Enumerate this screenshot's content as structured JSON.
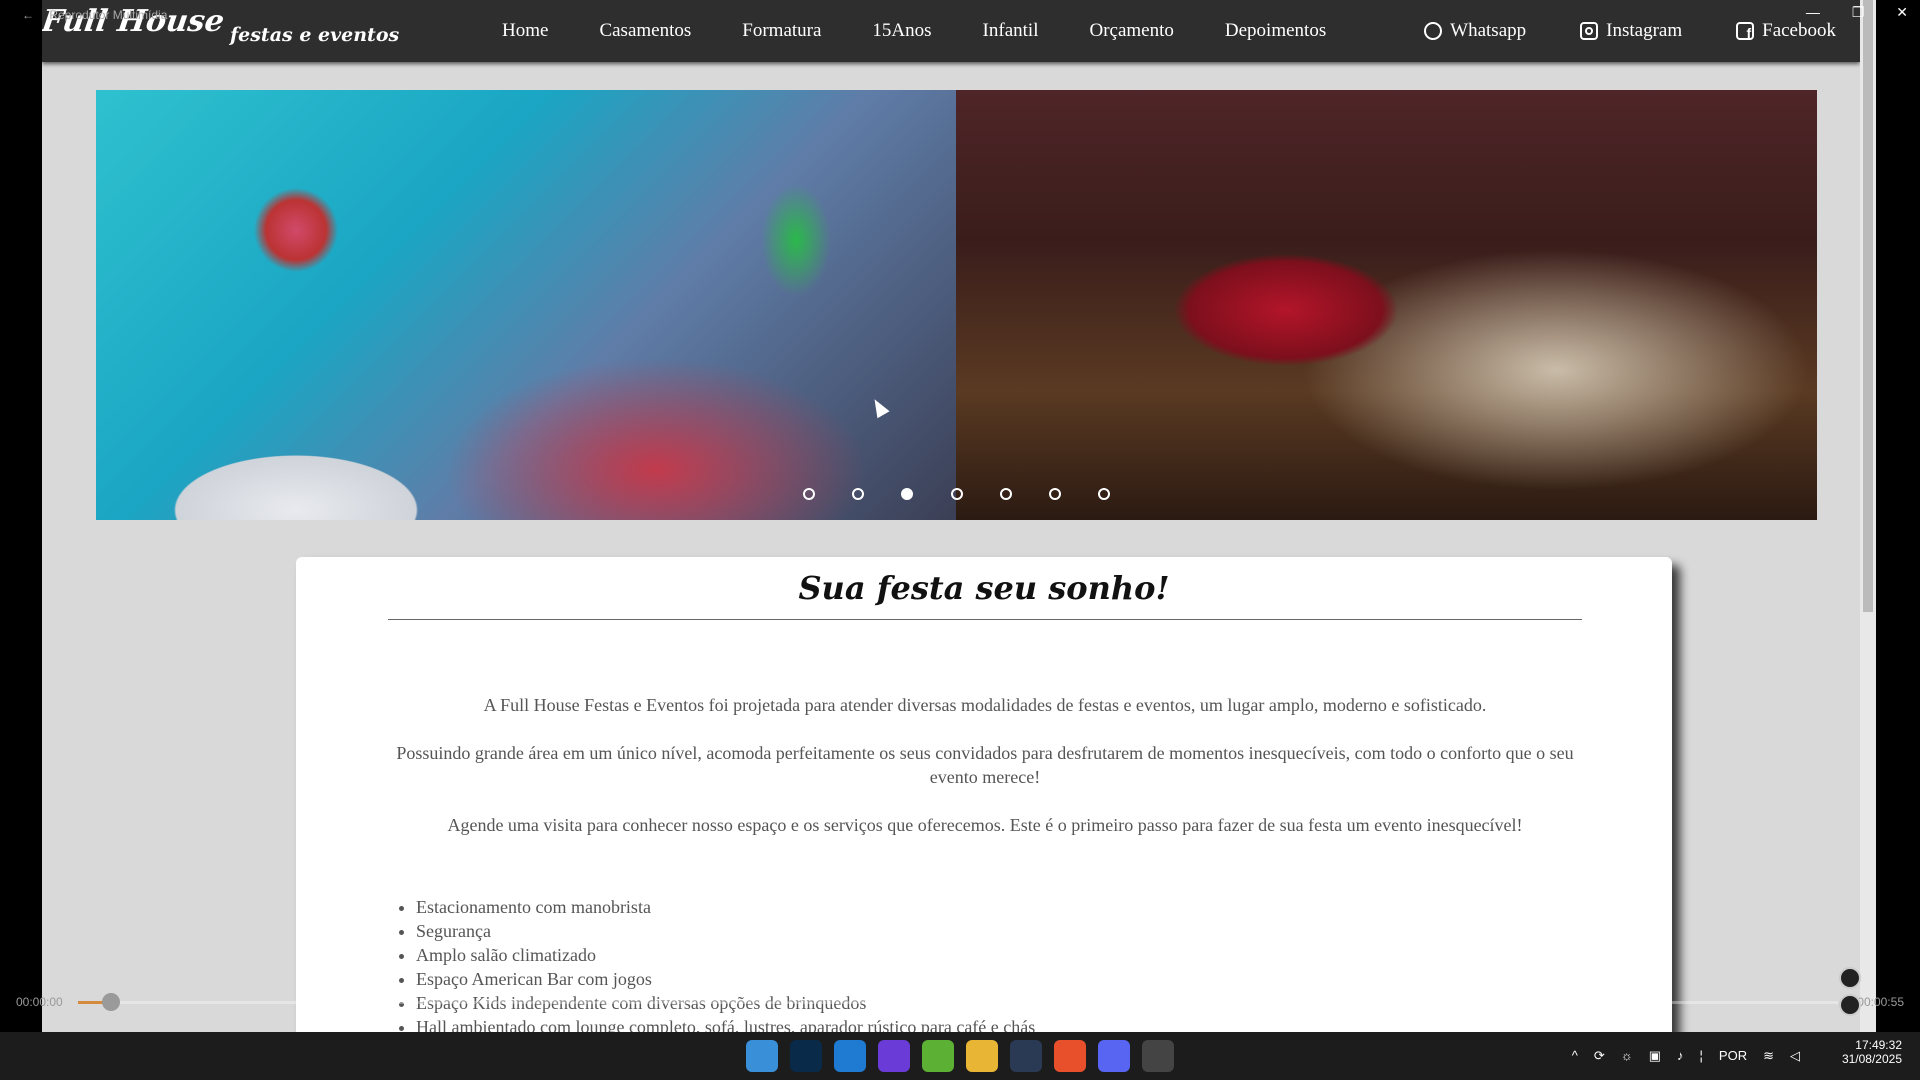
{
  "player": {
    "title": "Reprodutor Multimídia",
    "elapsed": "00:00:00",
    "duration": "00:00:55",
    "progress": 0.02
  },
  "site": {
    "logo_main": "Full House",
    "logo_sub": "festas e eventos",
    "menu": [
      "Home",
      "Casamentos",
      "Formatura",
      "15Anos",
      "Infantil",
      "Orçamento",
      "Depoimentos"
    ],
    "social": [
      {
        "label": "Whatsapp",
        "icon": "whatsapp-icon"
      },
      {
        "label": "Instagram",
        "icon": "instagram-icon"
      },
      {
        "label": "Facebook",
        "icon": "facebook-icon"
      }
    ],
    "slider_dots": 7,
    "slider_active": 3
  },
  "card": {
    "title": "Sua festa seu sonho!",
    "p1": "A Full House Festas e Eventos foi projetada para atender diversas modalidades de festas e eventos, um lugar amplo, moderno e sofisticado.",
    "p2": "Possuindo grande área em um único nível, acomoda perfeitamente os seus convidados para desfrutarem de momentos inesquecíveis, com todo o conforto que o seu evento merece!",
    "p3": "Agende uma visita para conhecer nosso espaço e os serviços que oferecemos. Este é o primeiro passo para fazer de sua festa um evento inesquecível!",
    "features": [
      "Estacionamento com manobrista",
      "Segurança",
      "Amplo salão climatizado",
      "Espaço American Bar com jogos",
      "Espaço Kids independente com diversas opções de brinquedos",
      "Hall ambientado com lounge completo, sofá, lustres, aparador rústico para café e chás"
    ]
  },
  "taskbar": {
    "apps": [
      "windows-start-icon",
      "photoshop-icon",
      "vscode-icon",
      "intellij-icon",
      "spring-icon",
      "file-explorer-icon",
      "steam-icon",
      "brave-icon",
      "discord-icon",
      "media-player-icon"
    ],
    "lang": "POR",
    "time": "17:49:32",
    "date": "31/08/2025"
  },
  "colors": {
    "navbar": "#2e2e2e",
    "page_bg": "#d9d9d9",
    "progress": "#d68a3c"
  }
}
